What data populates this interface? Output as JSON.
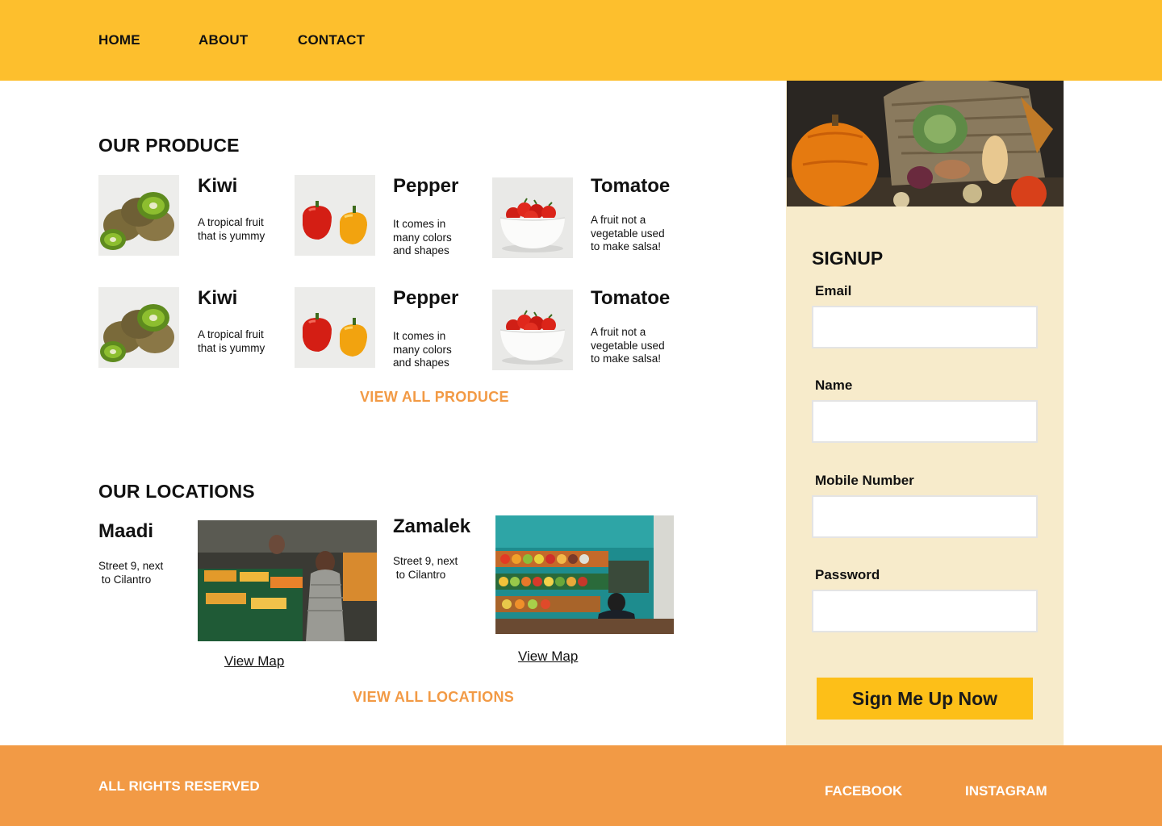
{
  "nav": {
    "home": "HOME",
    "about": "ABOUT",
    "contact": "CONTACT"
  },
  "produce": {
    "title": "OUR PRODUCE",
    "items": [
      {
        "name": "Kiwi",
        "desc": "A tropical fruit\nthat is yummy",
        "icon": "kiwi-image"
      },
      {
        "name": "Pepper",
        "desc": "It comes in\nmany colors\nand shapes",
        "icon": "pepper-image"
      },
      {
        "name": "Tomatoe",
        "desc": "A fruit not a\nvegetable used\nto make salsa!",
        "icon": "tomato-bowl-image"
      },
      {
        "name": "Kiwi",
        "desc": "A tropical fruit\nthat is yummy",
        "icon": "kiwi-image"
      },
      {
        "name": "Pepper",
        "desc": "It comes in\nmany colors\nand shapes",
        "icon": "pepper-image"
      },
      {
        "name": "Tomatoe",
        "desc": "A fruit not a\nvegetable used\nto make salsa!",
        "icon": "tomato-bowl-image"
      }
    ],
    "view_all": "VIEW ALL PRODUCE"
  },
  "locations": {
    "title": "OUR LOCATIONS",
    "items": [
      {
        "name": "Maadi",
        "address": "Street 9, next\n to Cilantro",
        "map_link": "View Map"
      },
      {
        "name": "Zamalek",
        "address": "Street 9, next\n to Cilantro",
        "map_link": "View Map"
      }
    ],
    "view_all": "VIEW ALL LOCATIONS"
  },
  "signup": {
    "title": "SIGNUP",
    "fields": [
      {
        "label": "Email",
        "value": "",
        "placeholder": ""
      },
      {
        "label": "Name",
        "value": "",
        "placeholder": ""
      },
      {
        "label": "Mobile Number",
        "value": "",
        "placeholder": ""
      },
      {
        "label": "Password",
        "value": "",
        "placeholder": ""
      }
    ],
    "button": "Sign Me Up Now"
  },
  "footer": {
    "rights": "ALL RIGHTS RESERVED",
    "facebook": "FACEBOOK",
    "instagram": "INSTAGRAM"
  },
  "colors": {
    "header": "#FDBF2D",
    "accent_orange": "#F29A45",
    "sidebar_bg": "#F7EBCB",
    "button": "#FDBF18"
  }
}
